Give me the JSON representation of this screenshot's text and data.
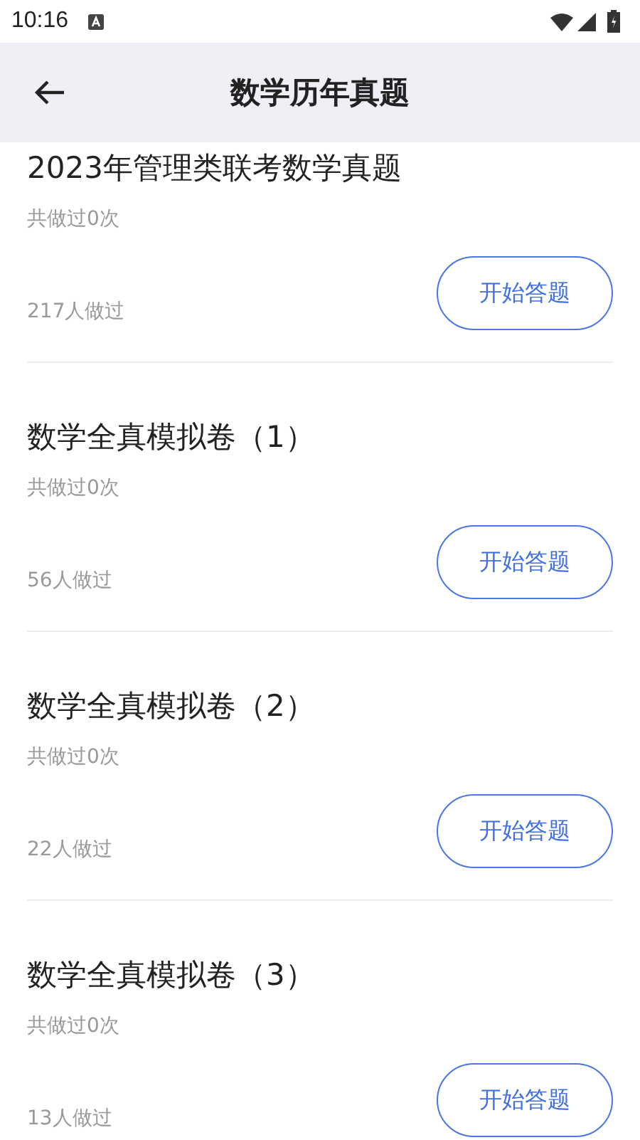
{
  "status_bar": {
    "time": "10:16"
  },
  "header": {
    "title": "数学历年真题"
  },
  "papers": [
    {
      "title": "2023年管理类联考数学真题",
      "attempts": "共做过0次",
      "participants": "217人做过",
      "button": "开始答题"
    },
    {
      "title": "数学全真模拟卷（1）",
      "attempts": "共做过0次",
      "participants": "56人做过",
      "button": "开始答题"
    },
    {
      "title": "数学全真模拟卷（2）",
      "attempts": "共做过0次",
      "participants": "22人做过",
      "button": "开始答题"
    },
    {
      "title": "数学全真模拟卷（3）",
      "attempts": "共做过0次",
      "participants": "13人做过",
      "button": "开始答题"
    }
  ]
}
